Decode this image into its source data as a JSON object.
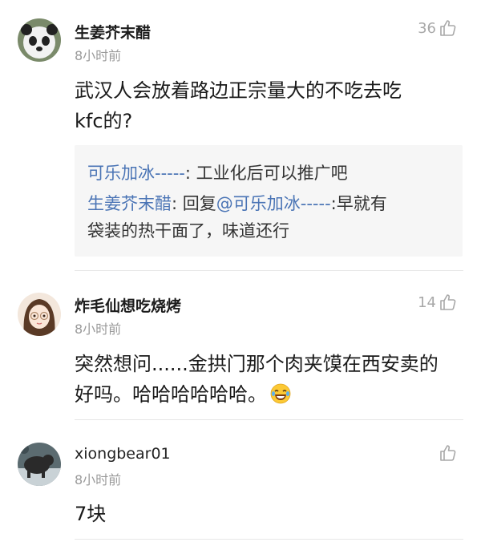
{
  "comments": [
    {
      "username": "生姜芥末醋",
      "time": "8小时前",
      "likes": "36",
      "text_line1": "武汉人会放着路边正宗量大的不吃去吃",
      "text_line2": "kfc的?",
      "avatar": "panda-avatar",
      "replies": [
        {
          "name": "可乐加冰-----",
          "sep": ": ",
          "text": "工业化后可以推广吧"
        },
        {
          "name": "生姜芥末醋",
          "sep": ": ",
          "prefix": "回复",
          "mention": "@可乐加冰-----",
          "text_a": ":早就有",
          "text_b": "袋装的热干面了，味道还行"
        }
      ]
    },
    {
      "username": "炸毛仙想吃烧烤",
      "time": "8小时前",
      "likes": "14",
      "text_line1": "突然想问......金拱门那个肉夹馍在西安卖的",
      "text_line2": "好吗。哈哈哈哈哈哈。",
      "emoji": "laughing-tears-emoji",
      "avatar": "girl-glasses-avatar"
    },
    {
      "username": "xiongbear01",
      "time": "8小时前",
      "likes": "",
      "text_line1": "7块",
      "avatar": "bear-photo-avatar"
    }
  ],
  "colors": {
    "link": "#4a74b5",
    "muted": "#9a9a9a",
    "reply_bg": "#f6f6f6"
  }
}
